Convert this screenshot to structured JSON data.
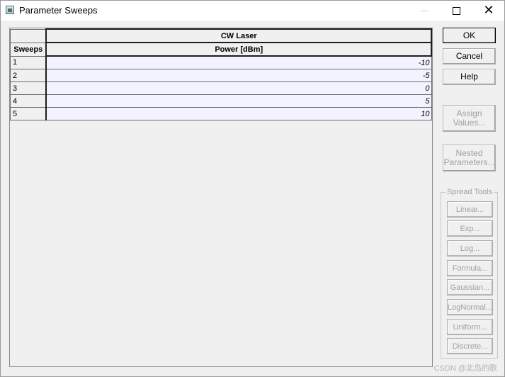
{
  "window": {
    "title": "Parameter Sweeps",
    "icon": "app-window-icon"
  },
  "titlebar_controls": {
    "minimize": "minimize-icon",
    "maximize": "maximize-icon",
    "close": "close-icon"
  },
  "table": {
    "component": "CW Laser",
    "row_header": "Sweeps",
    "parameter": "Power [dBm]",
    "rows": [
      {
        "index": "1",
        "value": "-10"
      },
      {
        "index": "2",
        "value": "-5"
      },
      {
        "index": "3",
        "value": "0"
      },
      {
        "index": "4",
        "value": "5"
      },
      {
        "index": "5",
        "value": "10"
      }
    ]
  },
  "buttons": {
    "ok": "OK",
    "cancel": "Cancel",
    "help": "Help",
    "assign_values": "Assign Values...",
    "nested_parameters": "Nested Parameters..."
  },
  "spread_tools": {
    "label": "Spread Tools",
    "items": [
      "Linear...",
      "Exp...",
      "Log...",
      "Formula...",
      "Gaussian...",
      "LogNormal...",
      "Uniform...",
      "Discrete..."
    ]
  },
  "watermark": "CSDN @北岛的歌"
}
